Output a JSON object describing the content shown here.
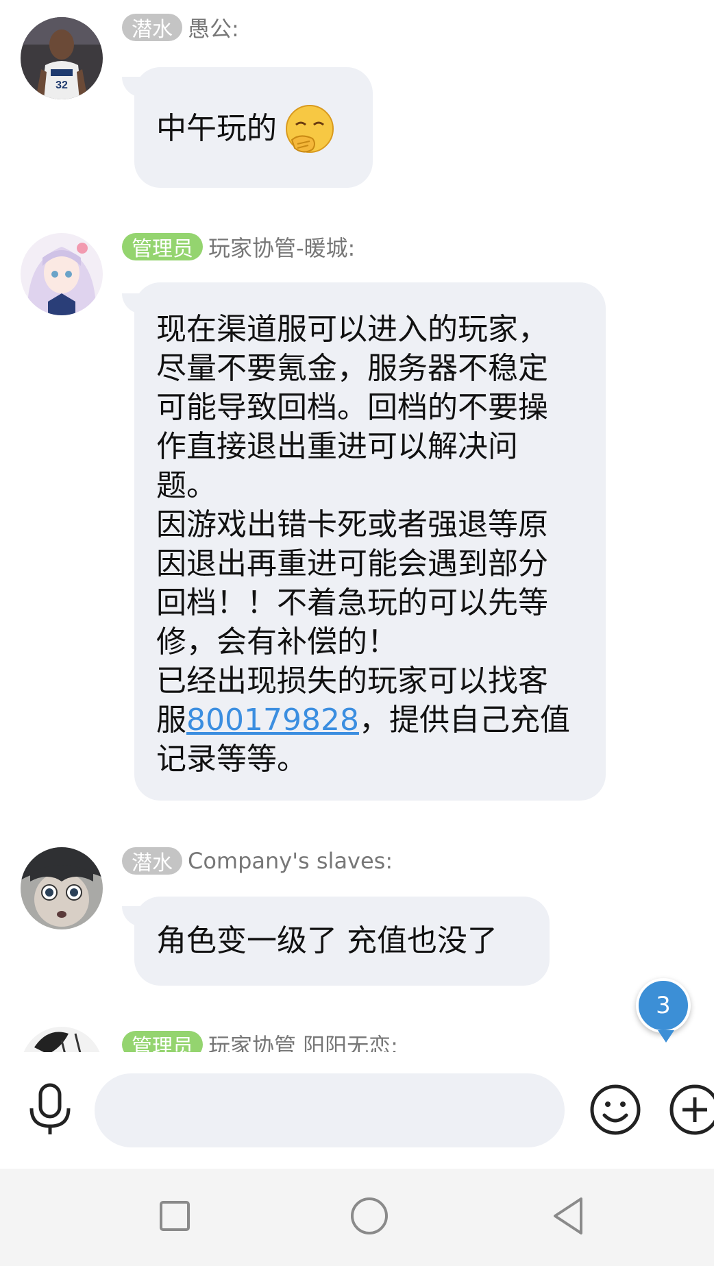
{
  "messages": [
    {
      "badge": "潜水",
      "badge_type": "diver",
      "sender": "愚公:",
      "text": "中午玩的",
      "emoji": "face-with-hand-over-mouth-emoji"
    },
    {
      "badge": "管理员",
      "badge_type": "admin",
      "sender": "玩家协管-暖城:",
      "lines": [
        "现在渠道服可以进入的玩家，",
        "尽量不要氪金，服务器不稳定",
        "可能导致回档。回档的不要操",
        "作直接退出重进可以解决问",
        "题。",
        "因游戏出错卡死或者强退等原",
        "因退出再重进可能会遇到部分",
        "回档！！不着急玩的可以先等",
        "修，会有补偿的！",
        "已经出现损失的玩家可以找客"
      ],
      "line_link_prefix": "服",
      "link": "800179828",
      "line_link_suffix": "，提供自己充值",
      "last_line": "记录等等。"
    },
    {
      "badge": "潜水",
      "badge_type": "diver",
      "sender": "Company's slaves:",
      "text": "角色变一级了  充值也没了"
    },
    {
      "badge": "管理员",
      "badge_type": "admin",
      "sender": "玩家协管 阳阳无恋:"
    }
  ],
  "unread_count": "3",
  "icons": {
    "voice": "microphone-icon",
    "emoji": "smiley-icon",
    "more": "plus-icon",
    "recent": "square-icon",
    "home": "circle-icon",
    "back": "triangle-back-icon"
  },
  "colors": {
    "bubble": "#eef0f5",
    "admin_badge": "#94d46f",
    "diver_badge": "#c4c4c4",
    "link": "#3b8ee0",
    "unread": "#3c8fd6"
  }
}
